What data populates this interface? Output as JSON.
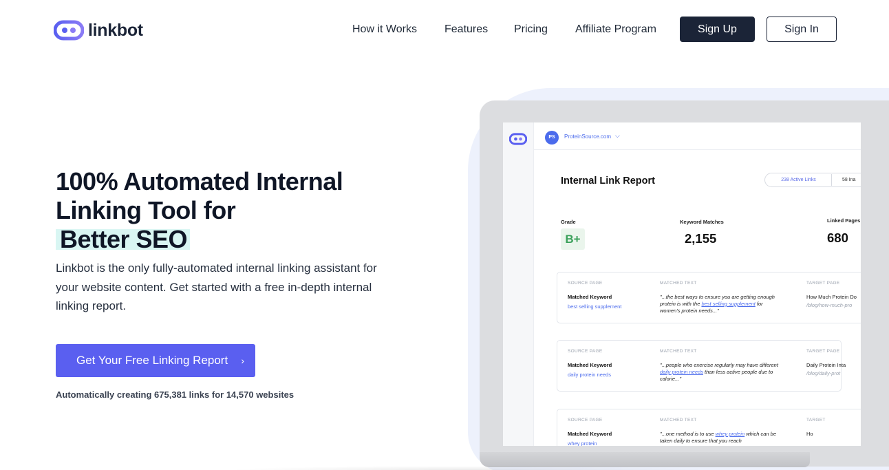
{
  "brand": {
    "name": "linkbot",
    "accent": "#5a5ff0",
    "dark": "#1b2437",
    "icon": "link-chain-icon"
  },
  "nav": {
    "links": [
      "How it Works",
      "Features",
      "Pricing",
      "Affiliate Program"
    ],
    "signup": "Sign Up",
    "signin": "Sign In"
  },
  "hero": {
    "title_line1": "100% Automated Internal",
    "title_line2": "Linking Tool for",
    "title_highlight": "Better SEO",
    "description": "Linkbot is the only fully-automated internal linking assistant for your website content. Get started with a free in-depth internal linking report.",
    "cta": "Get Your Free Linking Report",
    "cta_icon": "chevron-right-icon",
    "stats": "Automatically creating 675,381 links for 14,570 websites"
  },
  "app": {
    "avatar": "PS",
    "site": "ProteinSource.com",
    "report_title": "Internal Link Report",
    "toggle_active": "238 Active Links",
    "toggle_inactive": "58 Ina",
    "grade_label": "Grade",
    "grade": "B+",
    "keyword_matches_label": "Keyword Matches",
    "keyword_matches": "2,155",
    "linked_pages_label": "Linked  Pages",
    "linked_pages": "680",
    "col_source": "SOURCE PAGE",
    "col_matched": "MATCHED TEXT",
    "col_target": "TARGET PAGE",
    "matched_keyword_label": "Matched Keyword",
    "rows": [
      {
        "keyword": "best selling supplement",
        "quote_pre": "\"...the best ways to ensure you are getting enough protein is with the ",
        "quote_link": "best selling supplement",
        "quote_post": " for women's protein needs...\"",
        "target_title": "How Much Protein Do",
        "target_url": "/blog/how-much-pro",
        "target_header": "TARGET PAGE"
      },
      {
        "keyword": "daily protein needs",
        "quote_pre": "\"...people who exercise regularly may have different ",
        "quote_link": "daily protein needs",
        "quote_post": " than less active people due to calorie...\"",
        "target_title": "Daily Protein Inta",
        "target_url": "/blog/daily-prot",
        "target_header": "TARGET PAGE"
      },
      {
        "keyword": "whey protein",
        "quote_pre": "\"...one method is to use ",
        "quote_link": "whey protein",
        "quote_post": " which can be taken daily to ensure that you reach",
        "target_title": "Ho",
        "target_url": "",
        "target_header": "TARGET"
      }
    ]
  }
}
